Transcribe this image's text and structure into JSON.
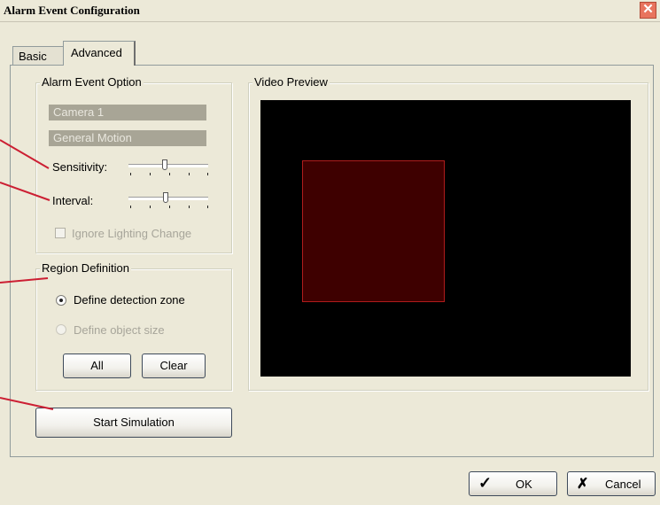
{
  "window": {
    "title": "Alarm Event Configuration",
    "close_glyph": "✕"
  },
  "tabs": [
    {
      "label": "Basic"
    },
    {
      "label": "Advanced"
    }
  ],
  "alarm_event_option": {
    "legend": "Alarm Event Option",
    "camera": "Camera 1",
    "event_type": "General Motion",
    "sensitivity_label": "Sensitivity:",
    "sensitivity_level": 0.45,
    "interval_label": "Interval:",
    "interval_level": 0.47,
    "ignore_lighting_label": "Ignore Lighting Change",
    "ignore_lighting_checked": false
  },
  "region_definition": {
    "legend": "Region Definition",
    "option_zone": "Define detection zone",
    "option_size": "Define object size",
    "selected": "zone",
    "all_label": "All",
    "clear_label": "Clear"
  },
  "start_simulation_label": "Start Simulation",
  "video_preview": {
    "legend": "Video Preview"
  },
  "footer": {
    "ok_label": "OK",
    "cancel_label": "Cancel"
  },
  "colors": {
    "callout": "#cc1f33",
    "zone_fill": "#3e0000",
    "zone_border": "#b01c1c"
  },
  "icons": {
    "ok": "checkmark-icon",
    "cancel": "x-icon"
  }
}
